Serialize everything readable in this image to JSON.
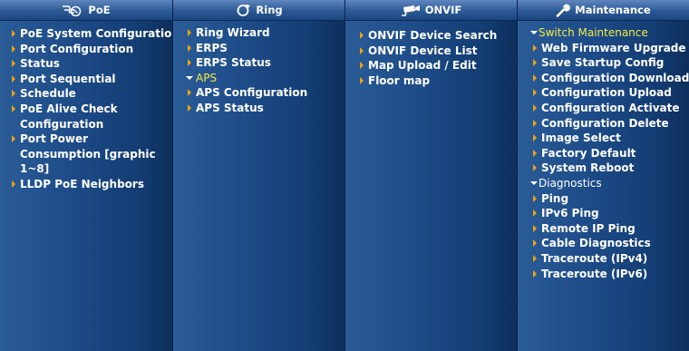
{
  "menus": {
    "poe": {
      "title": "PoE",
      "icon": "poe-plug-icon",
      "items": [
        "PoE System Configuration",
        "Port Configuration",
        "Status",
        "Port Sequential",
        "Schedule",
        "PoE Alive Check Configuration",
        "Port Power Consumption [graphic 1~8]",
        "LLDP PoE Neighbors"
      ]
    },
    "ring": {
      "title": "Ring",
      "icon": "ring-icon",
      "items": [
        "Ring Wizard",
        "ERPS",
        "ERPS Status"
      ],
      "aps": {
        "label": "APS",
        "children": [
          "APS Configuration",
          "APS Status"
        ]
      }
    },
    "onvif": {
      "title": "ONVIF",
      "icon": "camera-icon",
      "items": [
        "ONVIF Device Search",
        "ONVIF Device List",
        "Map Upload / Edit",
        "Floor map"
      ]
    },
    "maintenance": {
      "title": "Maintenance",
      "icon": "wrench-icon",
      "switch_maintenance": {
        "label": "Switch Maintenance",
        "children": [
          "Web Firmware Upgrade",
          "Save Startup Config",
          "Configuration Download",
          "Configuration Upload",
          "Configuration Activate",
          "Configuration Delete",
          "Image Select",
          "Factory Default",
          "System Reboot"
        ]
      },
      "diagnostics": {
        "label": "Diagnostics",
        "children": [
          "Ping",
          "IPv6 Ping",
          "Remote IP Ping",
          "Cable Diagnostics",
          "Traceroute (IPv4)",
          "Traceroute (IPv6)"
        ]
      }
    }
  },
  "colors": {
    "accent_arrow": "#f0a30a",
    "expanded_label": "#f7e94a",
    "text": "#ffffff"
  }
}
